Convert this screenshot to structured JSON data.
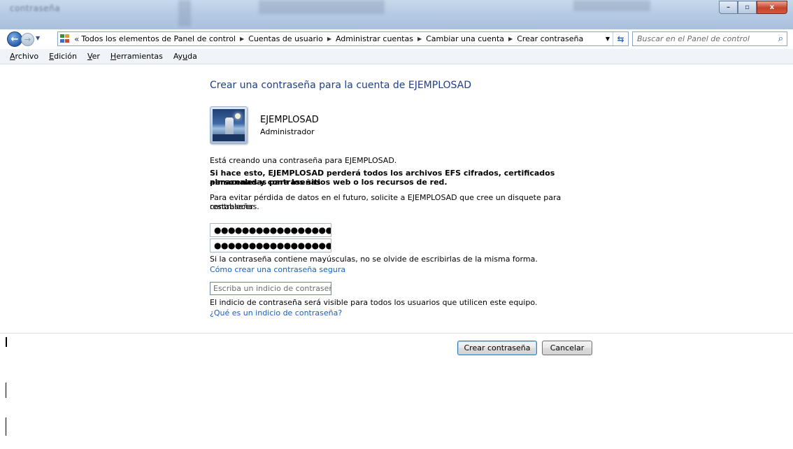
{
  "window": {
    "title": "contraseña",
    "controls": {
      "minimize": "–",
      "maximize": "▫",
      "close": "x"
    }
  },
  "address_bar": {
    "overflow": "«",
    "breadcrumbs": [
      "Todos los elementos de Panel de control",
      "Cuentas de usuario",
      "Administrar cuentas",
      "Cambiar una cuenta",
      "Crear contraseña"
    ]
  },
  "search": {
    "placeholder": "Buscar en el Panel de control"
  },
  "menu": {
    "items": [
      {
        "accel": "A",
        "rest": "rchivo"
      },
      {
        "accel": "E",
        "rest": "dición"
      },
      {
        "accel": "V",
        "rest": "er"
      },
      {
        "accel": "H",
        "rest": "erramientas"
      },
      {
        "pre": "Ay",
        "accel": "u",
        "rest": "da"
      }
    ]
  },
  "page": {
    "heading": "Crear una contraseña para la cuenta de EJEMPLOSAD",
    "account": {
      "name": "EJEMPLOSAD",
      "role": "Administrador"
    },
    "intro": "Está creando una contraseña para EJEMPLOSAD.",
    "warning_line1": "Si hace esto, EJEMPLOSAD perderá todos los archivos EFS cifrados, certificados personales y contraseñas",
    "warning_line2": "almacenadas para los sitios web o los recursos de red.",
    "advice_line1": "Para evitar pérdida de datos en el futuro, solicite a EJEMPLOSAD que cree un disquete para restablecer",
    "advice_line2": "contraseñas.",
    "password_mask": "●●●●●●●●●●●●●●●●●●●●●●",
    "confirm_mask": "●●●●●●●●●●●●●●●●●●●●●●",
    "caps_note": "Si la contraseña contiene mayúsculas, no se olvide de escribirlas de la misma forma.",
    "secure_link": "Cómo crear una contraseña segura",
    "hint_placeholder": "Escriba un indicio de contraseña",
    "hint_note": "El indicio de contraseña será visible para todos los usuarios que utilicen este equipo.",
    "hint_link": "¿Qué es un indicio de contraseña?"
  },
  "buttons": {
    "create": "Crear contraseña",
    "cancel": "Cancelar"
  },
  "colors": {
    "heading": "#1e3f8a",
    "link": "#1560c5",
    "titlebar": "#b7cbe3"
  }
}
